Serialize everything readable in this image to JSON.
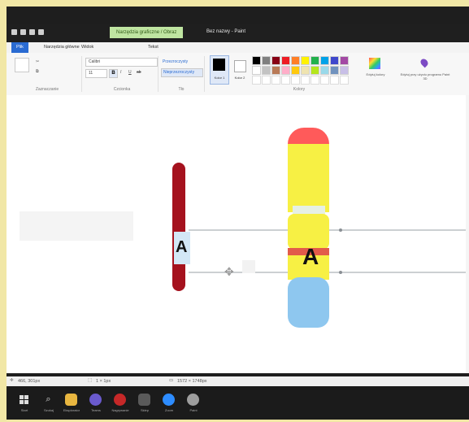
{
  "app": {
    "title": "Bez nazwy - Paint",
    "context_tab": "Narzędzia graficzne / Obraz"
  },
  "tabs": [
    {
      "label": "Plik",
      "active": true
    },
    {
      "label": "Narzędzia główne",
      "active": false
    },
    {
      "label": "Widok",
      "active": false
    },
    {
      "label": "Tekst",
      "active": false
    }
  ],
  "ribbon": {
    "groups": {
      "clipboard": "Zaznaczanie",
      "font": "Czcionka",
      "background": "Tło",
      "colors": "Kolory"
    },
    "font_name": "Calibri",
    "font_size": "11",
    "colour1_label": "Kolor 1",
    "colour2_label": "Kolor 2",
    "edit_colors_label": "Edytuj kolory",
    "paint3d_label": "Edytuj przy użyciu programu Paint 3D",
    "transparent_label": "Przezroczysty",
    "opaque_label": "Nieprzezroczysty",
    "swatches": [
      "#000000",
      "#7f7f7f",
      "#880015",
      "#ed1c24",
      "#ff7f27",
      "#fff200",
      "#22b14c",
      "#00a2e8",
      "#3f48cc",
      "#a349a4",
      "#ffffff",
      "#c3c3c3",
      "#b97a57",
      "#ffaec9",
      "#ffc90e",
      "#efe4b0",
      "#b5e61d",
      "#99d9ea",
      "#7092be",
      "#c8bfe7"
    ]
  },
  "canvas": {
    "small_label": "A",
    "big_label": "A",
    "colors": {
      "small_chromosome": "#a5121e",
      "big_top": "#ff5a5a",
      "big_yellow": "#f7f044",
      "big_red_band": "#e25b4a",
      "big_blue": "#8ec7ef"
    }
  },
  "status": {
    "coords": "466, 301px",
    "selection": "1 × 1px",
    "size": "1572 × 1748px"
  },
  "taskbar": {
    "items": [
      "Start",
      "Szukaj",
      "Eksplorator",
      "Teams",
      "Nagrywanie",
      "Sklep",
      "Zoom",
      "Paint"
    ]
  }
}
